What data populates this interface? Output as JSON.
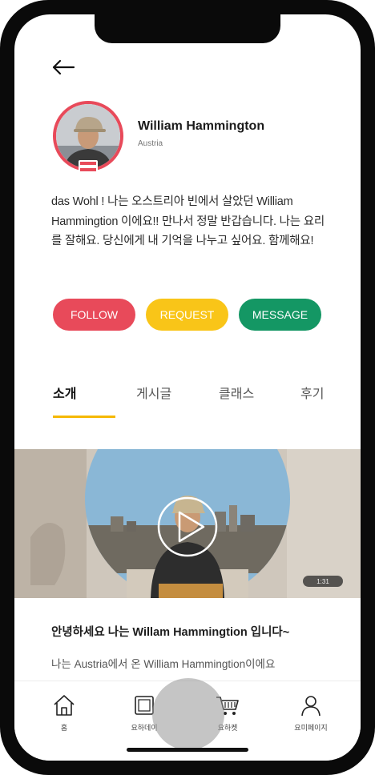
{
  "profile": {
    "name": "William Hammington",
    "country": "Austria",
    "bio": "das Wohl ! 나는 오스트리아 빈에서 살았던 William Hammingtion 이에요!! 만나서 정말 반갑습니다. 나는 요리를 잘해요. 당신에게 내 기억을 나누고 싶어요. 함께해요!"
  },
  "actions": {
    "follow": "FOLLOW",
    "request": "REQUEST",
    "message": "MESSAGE"
  },
  "tabs": [
    "소개",
    "게시글",
    "클래스",
    "후기"
  ],
  "active_tab": "소개",
  "video": {
    "duration": "1:31"
  },
  "content": {
    "title": "안녕하세요 나는 Willam Hammingtion 입니다~",
    "subtitle": "나는 Austria에서 온 William Hammingtion이에요"
  },
  "bottom_nav": [
    "홈",
    "요하데이",
    "요하켓",
    "요미페이지"
  ],
  "colors": {
    "follow": "#e84a5a",
    "request": "#f9c518",
    "message": "#149764",
    "tab_underline": "#f5b800"
  },
  "icons": {
    "back": "arrow-left-icon",
    "play": "play-icon",
    "home": "home-icon",
    "day": "photo-frame-icon",
    "market": "cart-icon",
    "mypage": "person-icon"
  }
}
